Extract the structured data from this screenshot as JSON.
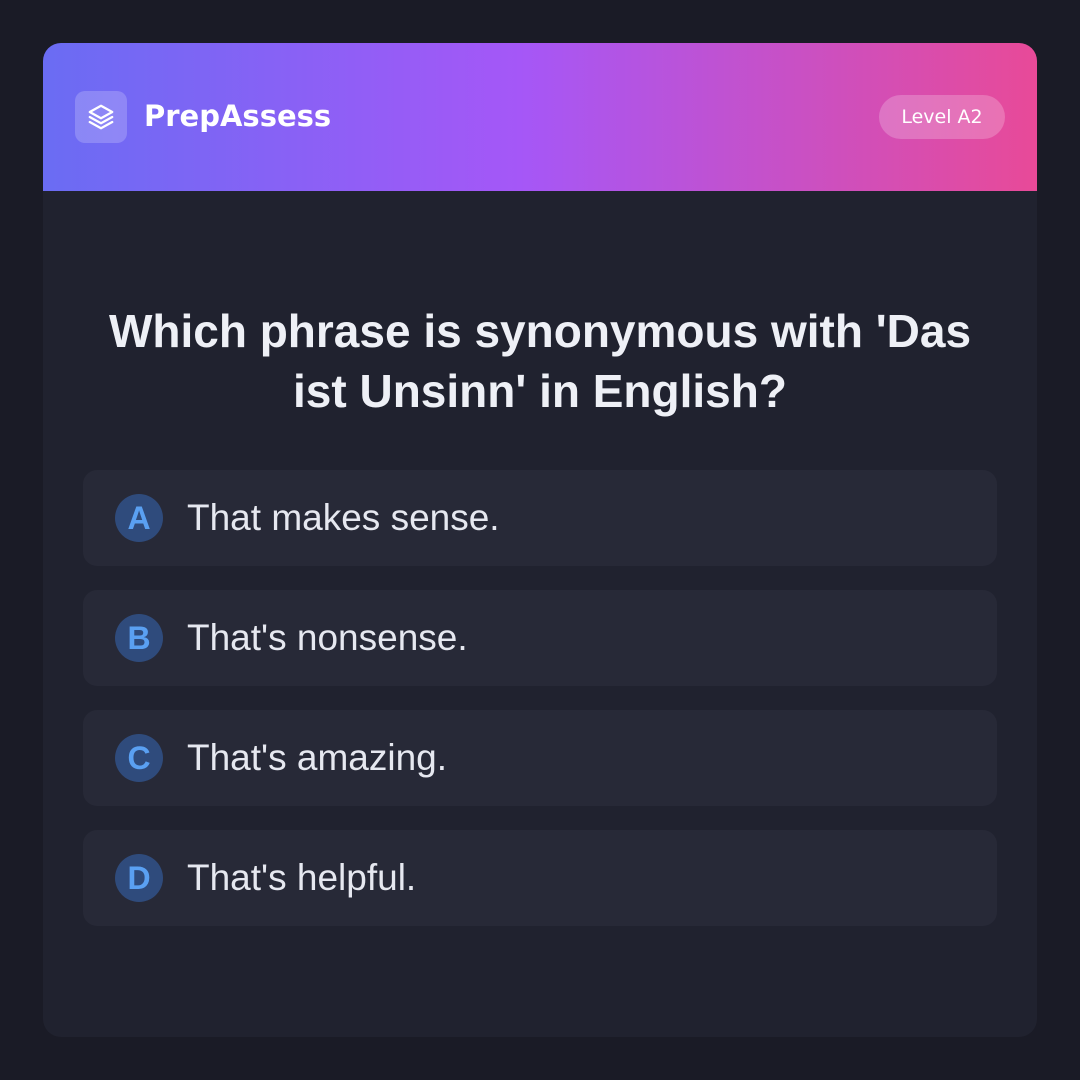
{
  "header": {
    "logo_icon": "layers-icon",
    "brand": "PrepAssess",
    "level_badge": "Level A2",
    "gradient_colors": [
      "#6a6cf3",
      "#a557f7",
      "#e84a98"
    ]
  },
  "question": {
    "text": "Which phrase is synonymous with 'Das ist Unsinn' in English?"
  },
  "options": [
    {
      "letter": "A",
      "text": "That makes sense."
    },
    {
      "letter": "B",
      "text": "That's nonsense."
    },
    {
      "letter": "C",
      "text": "That's amazing."
    },
    {
      "letter": "D",
      "text": "That's helpful."
    }
  ],
  "colors": {
    "background": "#1a1b26",
    "card": "#20222f",
    "option_bg": "#272937",
    "letter_circle": "#2f4b7c",
    "letter_text": "#5aa0f2"
  }
}
